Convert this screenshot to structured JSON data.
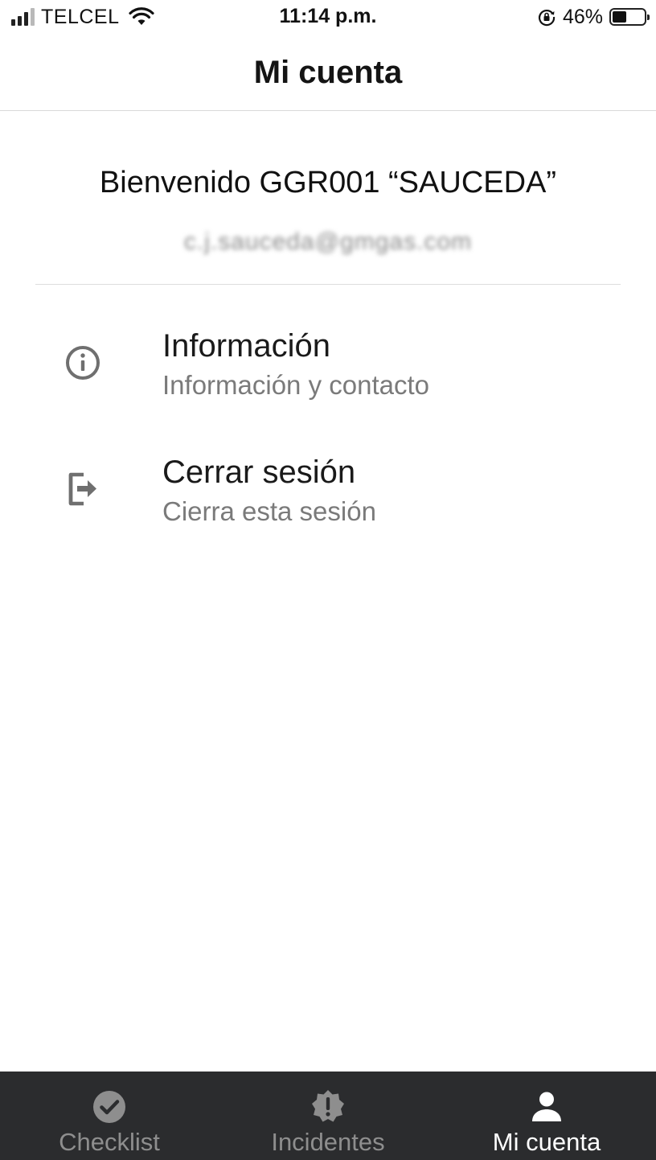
{
  "status_bar": {
    "carrier": "TELCEL",
    "time": "11:14 p.m.",
    "battery": "46%",
    "battery_level": 0.46,
    "icons": [
      "signal-icon",
      "wifi-icon",
      "rotation-lock-icon",
      "battery-icon"
    ]
  },
  "header": {
    "title": "Mi cuenta"
  },
  "account": {
    "welcome": "Bienvenido GGR001 “SAUCEDA”",
    "email": "c.j.sauceda@gmgas.com"
  },
  "menu": [
    {
      "title": "Información",
      "subtitle": "Información y contacto",
      "icon": "info-icon"
    },
    {
      "title": "Cerrar sesión",
      "subtitle": "Cierra esta sesión",
      "icon": "logout-icon"
    }
  ],
  "bottom_nav": [
    {
      "label": "Checklist",
      "icon": "check-circle-icon",
      "active": false
    },
    {
      "label": "Incidentes",
      "icon": "alert-badge-icon",
      "active": false
    },
    {
      "label": "Mi cuenta",
      "icon": "person-icon",
      "active": true
    }
  ],
  "colors": {
    "nav_background": "#2b2c2e",
    "nav_active": "#ffffff",
    "nav_inactive": "#8e8e8e",
    "subtitle": "#7a7a7a"
  }
}
